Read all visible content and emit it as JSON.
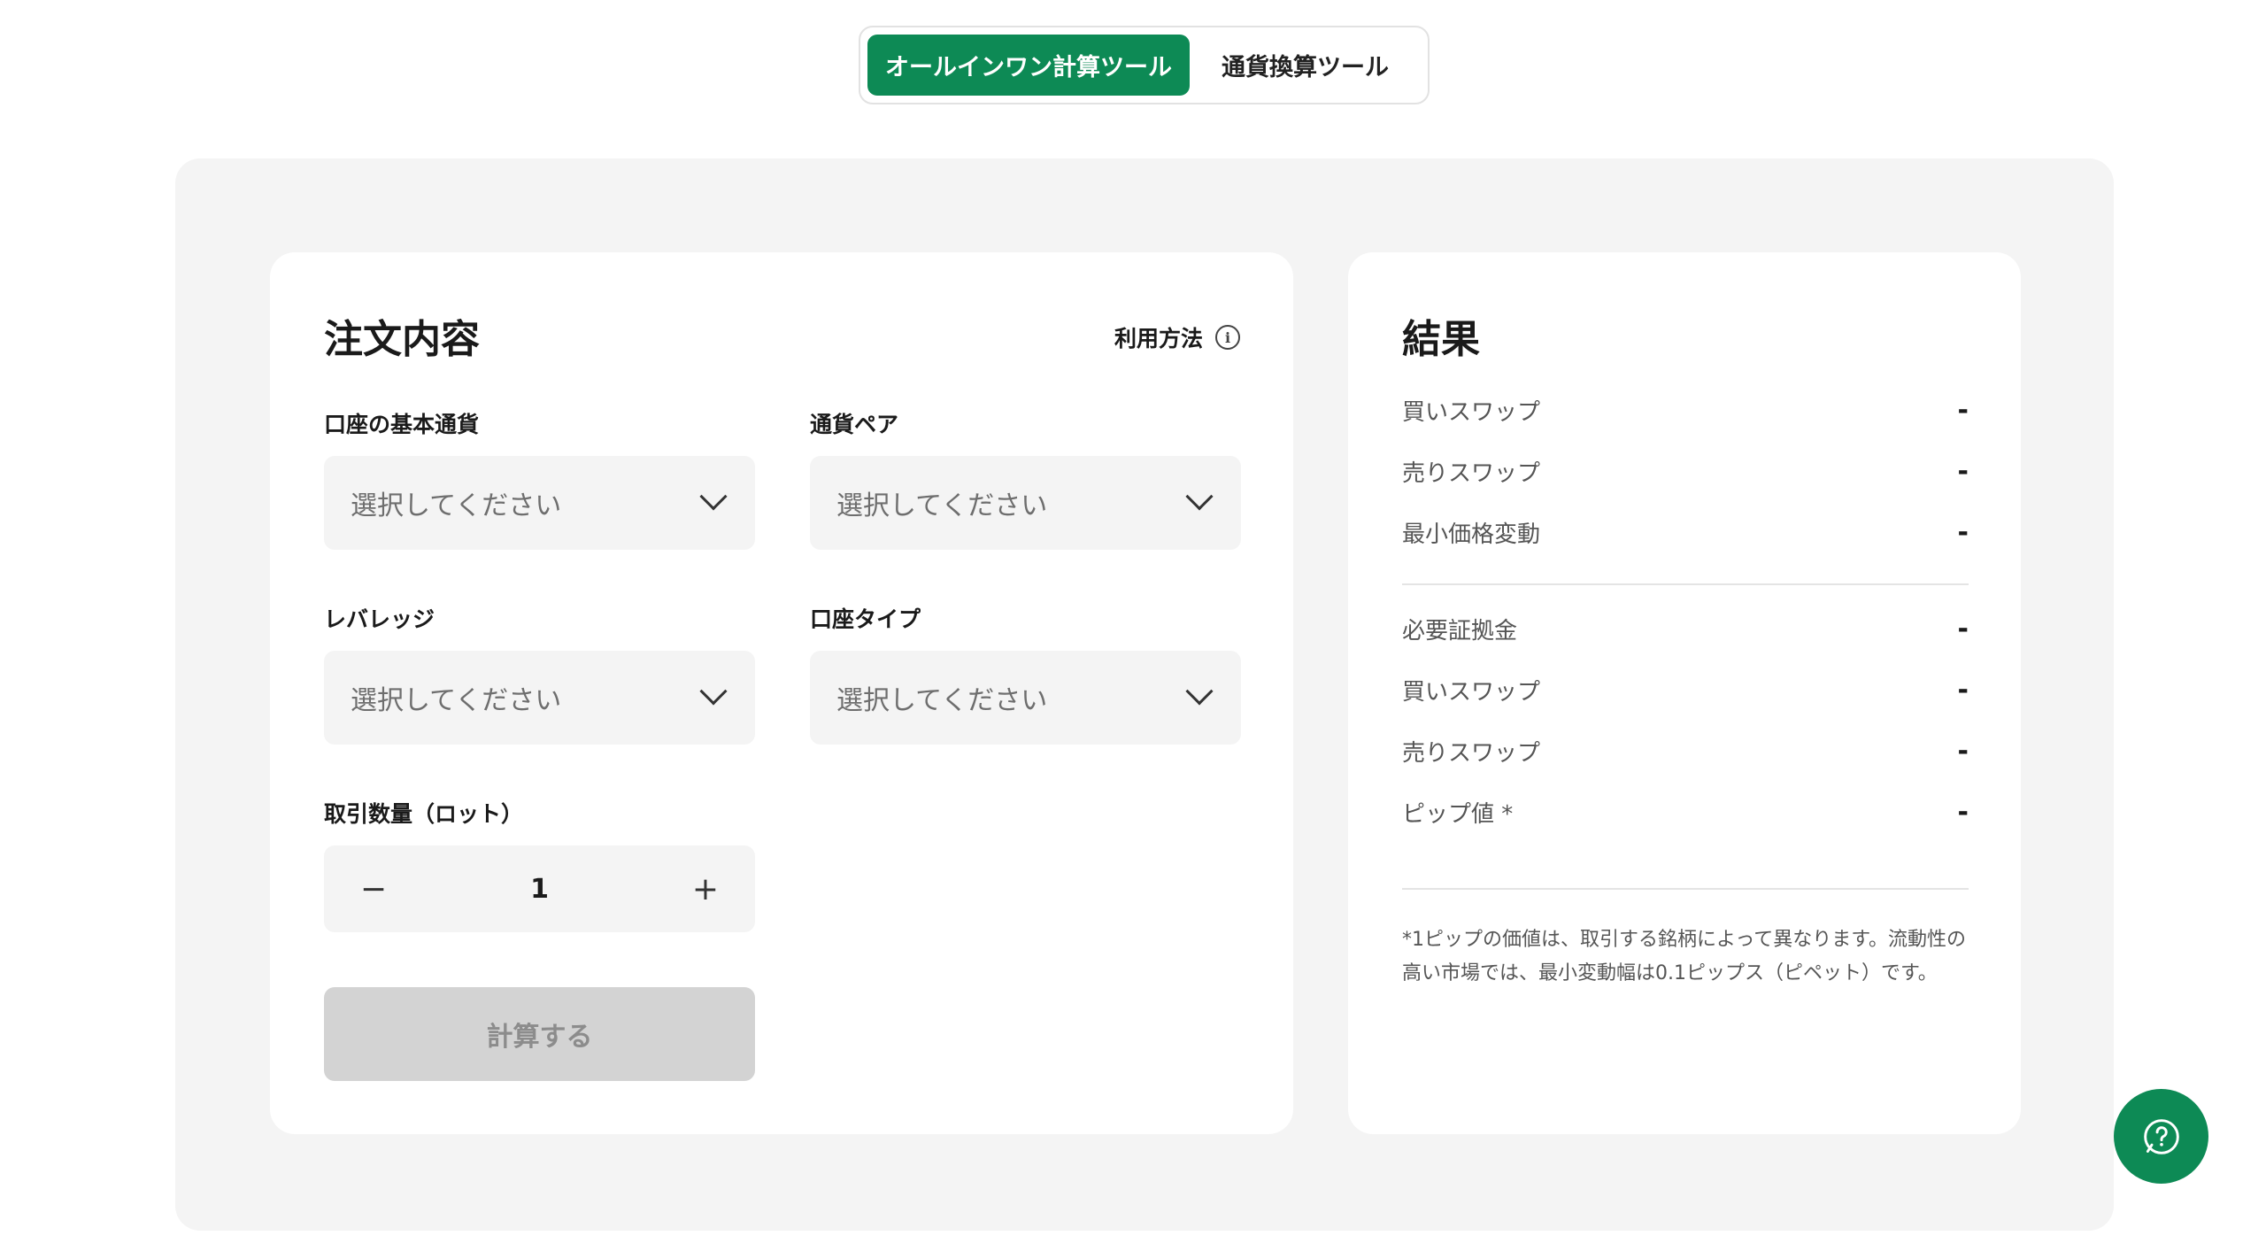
{
  "tabs": {
    "all_in_one": "オールインワン計算ツール",
    "currency_convert": "通貨換算ツール"
  },
  "order": {
    "title": "注文内容",
    "how_to": "利用方法",
    "fields": {
      "base_currency": {
        "label": "口座の基本通貨",
        "value": "選択してください"
      },
      "currency_pair": {
        "label": "通貨ペア",
        "value": "選択してください"
      },
      "leverage": {
        "label": "レバレッジ",
        "value": "選択してください"
      },
      "account_type": {
        "label": "口座タイプ",
        "value": "選択してください"
      }
    },
    "lot": {
      "label": "取引数量（ロット）",
      "value": "1",
      "minus": "−",
      "plus": "+"
    },
    "calculate_label": "計算する"
  },
  "result": {
    "title": "結果",
    "group1": [
      {
        "label": "買いスワップ",
        "value": "-"
      },
      {
        "label": "売りスワップ",
        "value": "-"
      },
      {
        "label": "最小価格変動",
        "value": "-"
      }
    ],
    "group2": [
      {
        "label": "必要証拠金",
        "value": "-"
      },
      {
        "label": "買いスワップ",
        "value": "-"
      },
      {
        "label": "売りスワップ",
        "value": "-"
      },
      {
        "label": "ピップ値 *",
        "value": "-"
      }
    ],
    "note": "*1ピップの価値は、取引する銘柄によって異なります。流動性の高い市場では、最小変動幅は0.1ピップス（ピペット）です。"
  },
  "icons": {
    "info": "info-icon",
    "chevron": "chevron-down-icon",
    "help": "help-chat-icon"
  },
  "colors": {
    "accent": "#0d8a55",
    "panel_bg": "#f4f4f4",
    "disabled_button": "#d3d3d3"
  }
}
